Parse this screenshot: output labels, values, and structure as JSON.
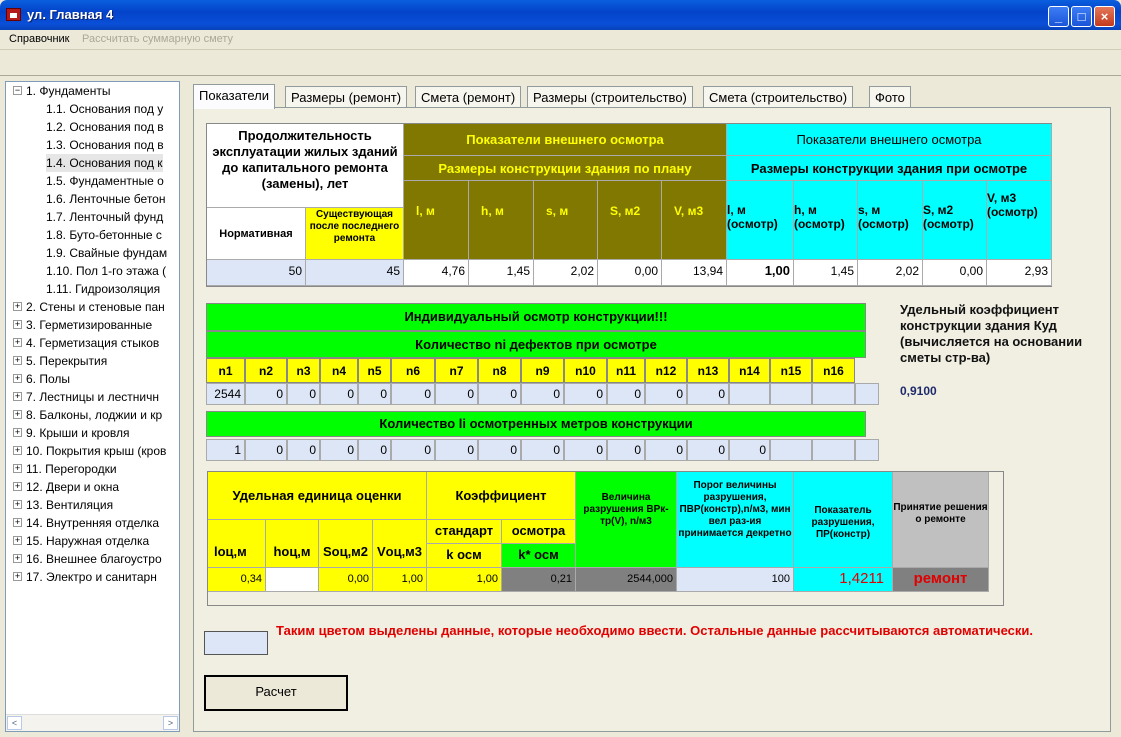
{
  "window": {
    "title": "ул. Главная 4",
    "buttons": [
      "_",
      "□",
      "×"
    ]
  },
  "menu": {
    "item1": "Справочник",
    "item2": "Рассчитать суммарную смету"
  },
  "tree": {
    "root1": "1. Фундаменты",
    "children": [
      "1.1. Основания под у",
      "1.2. Основания под в",
      "1.3. Основания под в",
      "1.4. Основания под к",
      "1.5. Фундаментные о",
      "1.6. Ленточные бетон",
      "1.7. Ленточный фунд",
      "1.8. Буто-бетонные с",
      "1.9. Свайные фундам",
      "1.10. Пол 1-го этажа (",
      "1.11. Гидроизоляция"
    ],
    "nodes": [
      "2. Стены и стеновые пан",
      "3. Герметизированные",
      "4. Герметизация стыков",
      "5. Перекрытия",
      "6. Полы",
      "7. Лестницы и лестничн",
      "8. Балконы, лоджии и кр",
      "9. Крыши и кровля",
      "10. Покрытия крыш (кров",
      "11. Перегородки",
      "12. Двери и окна",
      "13. Вентиляция",
      "14. Внутренняя отделка",
      "15. Наружная отделка",
      "16. Внешнее благоустро",
      "17. Электро и санитарн"
    ]
  },
  "tabs": [
    "Показатели",
    "Размеры (ремонт)",
    "Смета (ремонт)",
    "Размеры (строительство)",
    "Смета (строительство)",
    "Фото"
  ],
  "t1": {
    "duration_head": "Продолжительность эксплуатации жилых зданий до капитального ремонта (замены), лет",
    "norm": "Нормативная",
    "exist": "Существующая после последнего ремонта",
    "ext1": "Показатели внешнего осмотра",
    "plan": "Размеры конструкции здания по плану",
    "ext2": "Показатели внешнего осмотра",
    "inspect": "Размеры конструкции здания при осмотре",
    "plan_cols": [
      "l, м",
      "h, м",
      "s, м",
      "S, м2",
      "V, м3"
    ],
    "insp_cols": [
      "l, м (осмотр)",
      "h, м (осмотр)",
      "s, м (осмотр)",
      "S, м2 (осмотр)",
      "V, м3 (осмотр)"
    ],
    "values": [
      "50",
      "45",
      "4,76",
      "1,45",
      "2,02",
      "0,00",
      "13,94",
      "1,00",
      "1,45",
      "2,02",
      "0,00",
      "2,93"
    ]
  },
  "t2": {
    "head": "Индивидуальный осмотр конструкции!!!",
    "defects": "Количество ni дефектов при осмотре",
    "cols": [
      "n1",
      "n2",
      "n3",
      "n4",
      "n5",
      "n6",
      "n7",
      "n8",
      "n9",
      "n10",
      "n11",
      "n12",
      "n13",
      "n14",
      "n15",
      "n16"
    ],
    "row1": [
      "2544",
      "0",
      "0",
      "0",
      "0",
      "0",
      "0",
      "0",
      "0",
      "0",
      "0",
      "0",
      "0",
      "",
      "",
      ""
    ],
    "meters": "Количество li осмотренных метров конструкции",
    "row2": [
      "1",
      "0",
      "0",
      "0",
      "0",
      "0",
      "0",
      "0",
      "0",
      "0",
      "0",
      "0",
      "0",
      "0",
      "",
      ""
    ]
  },
  "coef": {
    "label": "Удельный коэффициент конструкции здания Куд (вычисляется на основании сметы стр-ва)",
    "value": "0,9100"
  },
  "t3": {
    "unit": "Удельная единица оценки",
    "koef": "Коэффициент",
    "std": "стандарт",
    "osm": "осмотра",
    "kosm": "k осм",
    "kstar": "k* осм",
    "cols": [
      "lоц,м",
      "hоц,м",
      "Sоц,м2",
      "Vоц,м3"
    ],
    "vel": "Величина разрушения ВРк-тр(V), n/м3",
    "porog": "Порог величины разрушения, ПВР(констр),n/м3, мин вел раз-ия принимается декретно",
    "pokaz": "Показатель разрушения, ПР(констр)",
    "decision": "Принятие решения о ремонте",
    "values": [
      "0,34",
      "",
      "0,00",
      "1,00",
      "1,00",
      "0,21",
      "2544,000",
      "100",
      "1,4211",
      "ремонт"
    ]
  },
  "note": "Таким цветом выделены данные, которые необходимо ввести. Остальные данные рассчитываются автоматически.",
  "calc_button": "Расчет"
}
